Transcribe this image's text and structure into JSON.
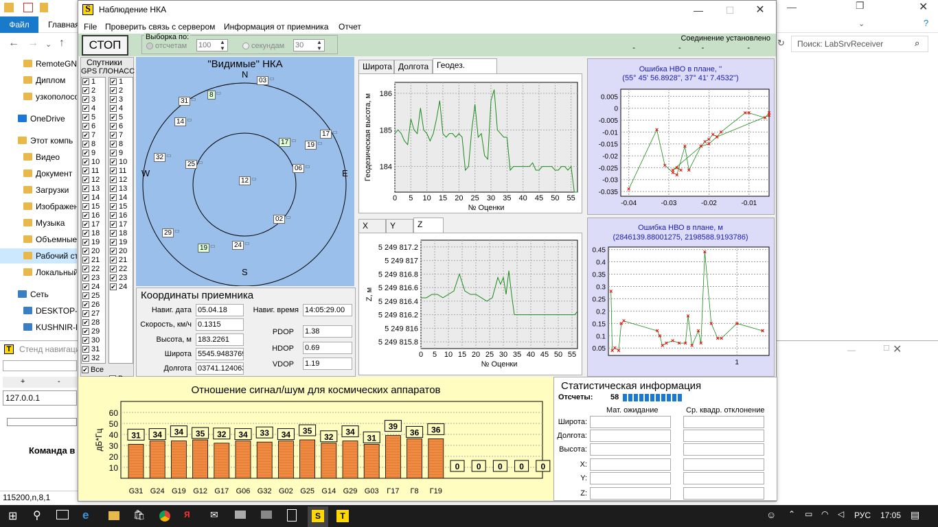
{
  "explorer": {
    "file_tab": "Файл",
    "main_tab": "Главная",
    "search_placeholder": "Поиск: LabSrvReceiver",
    "nav_items": [
      {
        "label": "RemoteGNS"
      },
      {
        "label": "Диплом"
      },
      {
        "label": "узкополосо"
      },
      {
        "label": "OneDrive"
      },
      {
        "label": "Этот компь"
      },
      {
        "label": "Видео"
      },
      {
        "label": "Документ"
      },
      {
        "label": "Загрузки"
      },
      {
        "label": "Изображен"
      },
      {
        "label": "Музыка"
      },
      {
        "label": "Объемные"
      },
      {
        "label": "Рабочий ст"
      },
      {
        "label": "Локальный"
      },
      {
        "label": "Сеть"
      },
      {
        "label": "DESKTOP-E"
      },
      {
        "label": "KUSHNIR-P"
      }
    ]
  },
  "stand": {
    "title": "Стенд навигаци",
    "address": "127.0.0.1",
    "command_label": "Команда в",
    "status": "115200,n,8,1",
    "plus": "+",
    "minus": "-"
  },
  "window": {
    "title": "Наблюдение НКА",
    "icon_letter": "S",
    "menu": [
      "File",
      "Проверить связь с сервером",
      "Информация от приемника",
      "Отчет"
    ]
  },
  "toolbar": {
    "stop_label": "СТОП",
    "sample_group_label": "Выборка по:",
    "by_count_label": "отсчетам",
    "by_count_value": "100",
    "by_seconds_label": "секундам",
    "by_seconds_value": "30",
    "connection_status": "Соединение установлено",
    "connection_marks": "- -- -"
  },
  "satellites": {
    "title": "Спутники",
    "gps_header": "GPS",
    "glonass_header": "ГЛОНАСС",
    "gps": [
      "1",
      "2",
      "3",
      "4",
      "5",
      "6",
      "7",
      "8",
      "9",
      "10",
      "11",
      "12",
      "13",
      "14",
      "15",
      "16",
      "17",
      "18",
      "19",
      "20",
      "21",
      "22",
      "23",
      "24",
      "25",
      "26",
      "27",
      "28",
      "29",
      "30",
      "31",
      "32"
    ],
    "glonass": [
      "1",
      "2",
      "3",
      "4",
      "5",
      "6",
      "7",
      "8",
      "9",
      "10",
      "11",
      "12",
      "13",
      "14",
      "15",
      "16",
      "17",
      "18",
      "19",
      "20",
      "21",
      "22",
      "23",
      "24"
    ],
    "all_label": "Все",
    "all_label_2": "Все"
  },
  "sky": {
    "title": "\"Видимые\" НКА",
    "north": "N",
    "south": "S",
    "east": "E",
    "west": "W",
    "sats": [
      {
        "id": "03",
        "green": false
      },
      {
        "id": "8",
        "green": true
      },
      {
        "id": "31",
        "green": false
      },
      {
        "id": "14",
        "green": false
      },
      {
        "id": "17",
        "green": true
      },
      {
        "id": "19",
        "green": false
      },
      {
        "id": "17",
        "green": false
      },
      {
        "id": "32",
        "green": false
      },
      {
        "id": "25",
        "green": false
      },
      {
        "id": "06",
        "green": false
      },
      {
        "id": "12",
        "green": false
      },
      {
        "id": "02",
        "green": false
      },
      {
        "id": "29",
        "green": false
      },
      {
        "id": "19",
        "green": true
      },
      {
        "id": "24",
        "green": false
      }
    ]
  },
  "coords": {
    "title": "Координаты приемника",
    "date_label": "Навиг. дата",
    "date_value": "05.04.18",
    "time_label": "Навиг. время",
    "time_value": "14:05:29.00",
    "speed_label": "Скорость, км/ч",
    "speed_value": "0.1315",
    "height_label": "Высота, м",
    "height_value": "183.2261",
    "lat_label": "Широта",
    "lat_value": "5545.9483769",
    "lon_label": "Долгота",
    "lon_value": "03741.124063",
    "pdop_label": "PDOP",
    "pdop_value": "1.38",
    "hdop_label": "HDOP",
    "hdop_value": "0.69",
    "vdop_label": "VDOP",
    "vdop_value": "1.19"
  },
  "geo_chart": {
    "tabs": [
      "Широта",
      "Долгота",
      "Геодез. высота"
    ],
    "active_tab": 2
  },
  "xyz_chart": {
    "tabs": [
      "X",
      "Y",
      "Z"
    ],
    "active_tab": 2
  },
  "err_chart1": {
    "title_line1": "Ошибка НВО в плане, ''",
    "title_line2": "(55° 45' 56.8928'', 37° 41' 7.4532'')"
  },
  "err_chart2": {
    "title_line1": "Ошибка НВО в плане, м",
    "title_line2": "(2846139.88001275, 2198588.9193786)"
  },
  "snr": {
    "title": "Отношение сигнал/шум для космических аппаратов"
  },
  "stats": {
    "title": "Статистическая информация",
    "count_label": "Отсчеты:",
    "count_value": "58",
    "progress": 0.7,
    "mean_header": "Мат. ожидание",
    "std_header": "Ср. квадр. отклонение",
    "rows": [
      "Широта:",
      "Долгота:",
      "Высота:",
      "X:",
      "Y:",
      "Z:"
    ]
  },
  "taskbar": {
    "lang": "РУС",
    "time": "17:05"
  },
  "chart_data": [
    {
      "type": "line",
      "xlabel": "№ Оценки",
      "ylabel": "Геодезическая высота, м",
      "xlim": [
        0,
        57
      ],
      "ylim": [
        183.3,
        186.3
      ],
      "xticks": [
        "0",
        "5",
        "10",
        "15",
        "20",
        "25",
        "30",
        "35",
        "40",
        "45",
        "50",
        "55"
      ],
      "yticks": [
        "184",
        "185",
        "186"
      ],
      "color": "#1a8a1a",
      "x": [
        0,
        1,
        2,
        3,
        4,
        5,
        6,
        7,
        8,
        9,
        10,
        11,
        12,
        13,
        14,
        15,
        16,
        17,
        18,
        19,
        20,
        21,
        22,
        23,
        24,
        25,
        26,
        27,
        28,
        29,
        30,
        31,
        32,
        33,
        34,
        35,
        36,
        37,
        38,
        39,
        40,
        41,
        42,
        43,
        44,
        45,
        46,
        47,
        48,
        49,
        50,
        51,
        52,
        53,
        54,
        55,
        56,
        57
      ],
      "y": [
        184.9,
        185.0,
        184.9,
        184.7,
        184.6,
        185.3,
        185.0,
        184.9,
        185.6,
        185.0,
        184.9,
        184.7,
        184.9,
        185.3,
        185.8,
        184.9,
        184.8,
        184.9,
        184.9,
        184.8,
        184.9,
        184.8,
        183.9,
        184.0,
        185.0,
        185.7,
        184.8,
        184.9,
        184.3,
        184.2,
        185.8,
        186.1,
        185.0,
        184.9,
        184.8,
        184.8,
        183.9,
        184.0,
        184.0,
        184.0,
        184.0,
        184.0,
        184.0,
        184.1,
        183.9,
        183.9,
        184.0,
        184.0,
        184.0,
        184.0,
        183.9,
        183.9,
        184.0,
        184.0,
        183.9,
        184.0,
        183.3,
        183.3
      ]
    },
    {
      "type": "line",
      "xlabel": "№ Оценки",
      "ylabel": "Z, м",
      "xlim": [
        0,
        57
      ],
      "ylim": [
        5249815.7,
        5249817.3
      ],
      "xticks": [
        "0",
        "5",
        "10",
        "15",
        "20",
        "25",
        "30",
        "35",
        "40",
        "45",
        "50",
        "55"
      ],
      "yticks": [
        "5 249 815.8",
        "5 249 816",
        "5 249 816.2",
        "5 249 816.4",
        "5 249 816.6",
        "5 249 816.8",
        "5 249 817",
        "5 249 817.2"
      ],
      "color": "#1a8a1a",
      "x": [
        0,
        2,
        4,
        6,
        8,
        10,
        12,
        14,
        16,
        18,
        20,
        22,
        24,
        26,
        28,
        29,
        30,
        31,
        32,
        33,
        34,
        36,
        38,
        40,
        42,
        44,
        46,
        48,
        50,
        52,
        54,
        56,
        57
      ],
      "y": [
        5249816.45,
        5249816.45,
        5249816.5,
        5249816.5,
        5249816.45,
        5249816.5,
        5249816.55,
        5249816.8,
        5249816.55,
        5249816.5,
        5249816.5,
        5249816.45,
        5249816.4,
        5249816.45,
        5249816.75,
        5249816.65,
        5249816.75,
        5249816.5,
        5249816.85,
        5249816.5,
        5249816.2,
        5249816.2,
        5249816.2,
        5249816.2,
        5249816.2,
        5249816.2,
        5249816.2,
        5249816.2,
        5249816.2,
        5249816.2,
        5249816.2,
        5249816.2,
        5249816.25
      ]
    },
    {
      "type": "scatter",
      "title": "Ошибка НВО в плане, ''",
      "xlim": [
        -0.042,
        -0.005
      ],
      "ylim": [
        -0.037,
        0.008
      ],
      "xticks": [
        "-0.04",
        "-0.03",
        "-0.02",
        "-0.01"
      ],
      "yticks": [
        "-0.035",
        "-0.03",
        "-0.025",
        "-0.02",
        "-0.015",
        "-0.01",
        "-0.005",
        "0",
        "0.005"
      ],
      "x": [
        -0.04,
        -0.033,
        -0.031,
        -0.029,
        -0.028,
        -0.026,
        -0.025,
        -0.022,
        -0.021,
        -0.02,
        -0.019,
        -0.018,
        -0.017,
        -0.011,
        -0.01,
        -0.006,
        -0.005,
        -0.005,
        -0.018,
        -0.02,
        -0.022,
        -0.029,
        -0.028,
        -0.027
      ],
      "y": [
        -0.034,
        -0.009,
        -0.024,
        -0.027,
        -0.028,
        -0.016,
        -0.026,
        -0.016,
        -0.014,
        -0.013,
        -0.011,
        -0.012,
        -0.01,
        -0.002,
        -0.002,
        -0.004,
        -0.002,
        -0.003,
        -0.012,
        -0.015,
        -0.016,
        -0.026,
        -0.025,
        -0.026
      ]
    },
    {
      "type": "scatter",
      "title": "Ошибка НВО в плане, м",
      "xlim": [
        0,
        1.25
      ],
      "ylim": [
        0.02,
        0.46
      ],
      "xticks": [
        "1"
      ],
      "yticks": [
        "0.05",
        "0.1",
        "0.15",
        "0.2",
        "0.25",
        "0.3",
        "0.35",
        "0.4",
        "0.45"
      ],
      "x": [
        0.02,
        0.03,
        0.05,
        0.08,
        0.1,
        0.12,
        0.38,
        0.4,
        0.42,
        0.45,
        0.5,
        0.55,
        0.6,
        0.62,
        0.65,
        0.7,
        0.72,
        0.75,
        0.8,
        0.85,
        0.88,
        1.0,
        1.2,
        1.2
      ],
      "y": [
        0.28,
        0.04,
        0.05,
        0.04,
        0.15,
        0.16,
        0.12,
        0.1,
        0.06,
        0.07,
        0.08,
        0.07,
        0.07,
        0.18,
        0.06,
        0.12,
        0.07,
        0.44,
        0.15,
        0.09,
        0.09,
        0.15,
        0.12,
        0.12
      ]
    },
    {
      "type": "bar",
      "ylabel": "дБ*Гц",
      "ylim": [
        0,
        70
      ],
      "yticks": [
        "10",
        "20",
        "30",
        "40",
        "50",
        "60"
      ],
      "categories": [
        "G31",
        "G24",
        "G19",
        "G12",
        "G17",
        "G06",
        "G32",
        "G02",
        "G25",
        "G14",
        "G29",
        "G03",
        "Г17",
        "Г8",
        "Г19",
        "",
        "",
        "",
        "",
        ""
      ],
      "values": [
        31,
        34,
        34,
        35,
        32,
        34,
        33,
        34,
        35,
        32,
        34,
        31,
        39,
        36,
        36,
        0,
        0,
        0,
        0,
        0
      ]
    }
  ]
}
